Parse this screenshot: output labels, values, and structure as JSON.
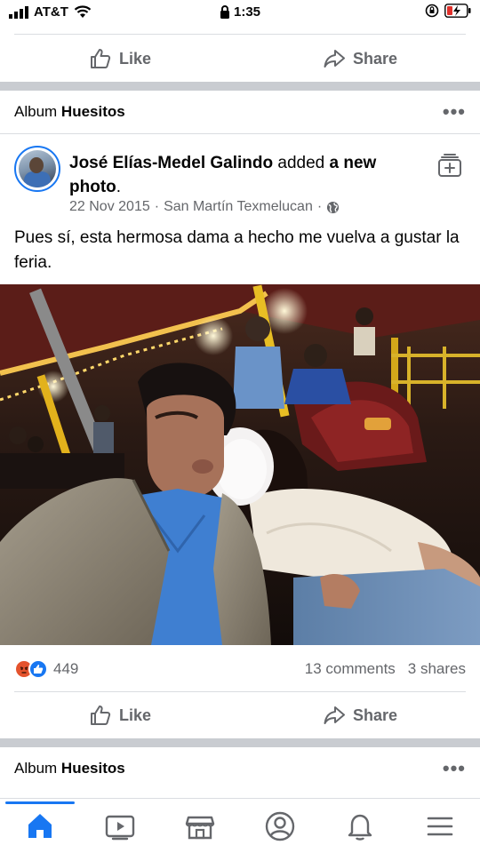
{
  "status_bar": {
    "carrier": "AT&T",
    "time": "1:35"
  },
  "top_actions": {
    "like_label": "Like",
    "share_label": "Share"
  },
  "album_header_1": {
    "prefix": "Album",
    "name": "Huesitos",
    "more": "•••"
  },
  "post": {
    "author": "José Elías-Medel Galindo",
    "action_pre": " added ",
    "action_bold": "a new photo",
    "action_post": ".",
    "date": "22 Nov 2015",
    "separator": "·",
    "location": "San Martín Texmelucan",
    "separator2": "·",
    "text": "Pues sí, esta hermosa dama a hecho me vuelva a gustar la feria.",
    "reaction_count": "449",
    "comments": "13 comments",
    "shares": "3 shares",
    "like_label": "Like",
    "share_label": "Share"
  },
  "album_header_2": {
    "prefix": "Album",
    "name": "Huesitos",
    "more": "•••"
  },
  "icons": {
    "privacy": "globe-icon",
    "save": "save-collection-icon",
    "reactions": [
      "angry-reaction-icon",
      "like-reaction-icon"
    ]
  },
  "bottom_nav": {
    "items": [
      "home-icon",
      "watch-icon",
      "marketplace-icon",
      "profile-icon",
      "notifications-icon",
      "menu-icon"
    ],
    "active": "home-icon"
  },
  "colors": {
    "accent": "#1877f2",
    "secondary_text": "#65676b",
    "angry": "#e4532d"
  }
}
